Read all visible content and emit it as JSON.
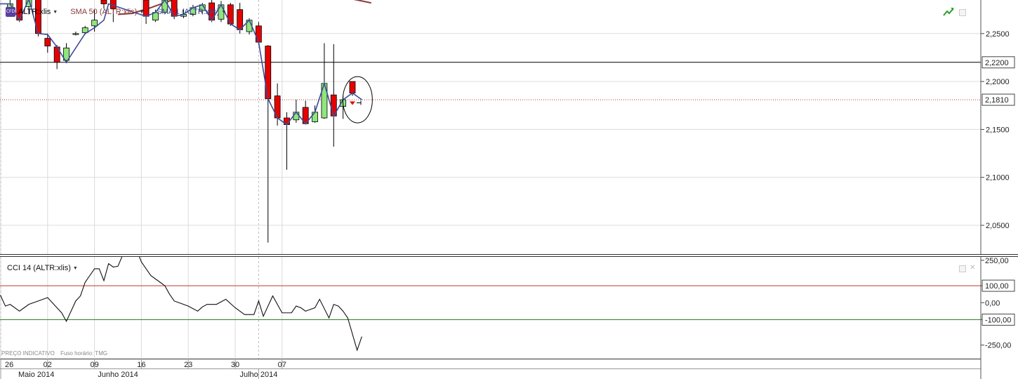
{
  "toolbar": {
    "symbol": "ALTR:xlis",
    "cfd_badge": "CFD",
    "sma50_label": "SMA 50 (ALTR:xlis)",
    "sma1_label": "SMA 1 (ALTR:xlis)"
  },
  "cci": {
    "label": "CCI 14 (ALTR:xlis)"
  },
  "footer": {
    "price_note": "PREÇO INDICATIVO",
    "tz_note": "Fuso horário: TMG"
  },
  "price_axis": {
    "ticks": [
      "2,2500",
      "2,2000",
      "2,1500",
      "2,1000",
      "2,0500"
    ],
    "tick_values": [
      2.25,
      2.2,
      2.15,
      2.1,
      2.05
    ],
    "hline_label": "2,2200",
    "hline_value": 2.22,
    "current_label": "2,1810",
    "current_value": 2.181
  },
  "cci_axis": {
    "ticks": [
      "250,00",
      "100,00",
      "0,00",
      "-100,00",
      "-250,00"
    ],
    "tick_values": [
      250,
      100,
      0,
      -100,
      -250
    ]
  },
  "date_axis": {
    "days": [
      {
        "label": "26",
        "x": 0
      },
      {
        "label": "02",
        "x": 5
      },
      {
        "label": "09",
        "x": 10
      },
      {
        "label": "16",
        "x": 15
      },
      {
        "label": "23",
        "x": 20
      },
      {
        "label": "30",
        "x": 25
      },
      {
        "label": "07",
        "x": 30
      }
    ],
    "months": [
      {
        "label": "Maio 2014",
        "x": 0
      },
      {
        "label": "Junho 2014",
        "x": 12.5
      },
      {
        "label": "Julho 2014",
        "x": 27.5
      }
    ]
  },
  "colors": {
    "up": "#90e57c",
    "down": "#e60000",
    "sma1": "#3c4c9a",
    "sma50": "#8b3a3a",
    "cci": "#111111",
    "cci_upper": "#c0392b",
    "cci_lower": "#1e7a1e",
    "current": "#c0392b"
  },
  "chart_data": [
    {
      "type": "candlestick",
      "title": "ALTR:xlis",
      "x_unit": "trading day index",
      "ylim": [
        2.02,
        2.285
      ],
      "series_names": [
        "SMA 50 (ALTR:xlis)",
        "SMA 1 (ALTR:xlis)"
      ],
      "candles": [
        {
          "x": -0.5,
          "o": 2.283,
          "h": 2.289,
          "l": 2.266,
          "c": 2.281
        },
        {
          "x": 1,
          "o": 2.277,
          "h": 2.292,
          "l": 2.272,
          "c": 2.281
        },
        {
          "x": 2,
          "o": 2.286,
          "h": 2.29,
          "l": 2.262,
          "c": 2.264
        },
        {
          "x": 3,
          "o": 2.278,
          "h": 2.29,
          "l": 2.27,
          "c": 2.286
        },
        {
          "x": 4,
          "o": 2.286,
          "h": 2.29,
          "l": 2.247,
          "c": 2.25
        },
        {
          "x": 5,
          "o": 2.245,
          "h": 2.25,
          "l": 2.23,
          "c": 2.237
        },
        {
          "x": 6,
          "o": 2.236,
          "h": 2.238,
          "l": 2.213,
          "c": 2.22
        },
        {
          "x": 7,
          "o": 2.222,
          "h": 2.24,
          "l": 2.219,
          "c": 2.235
        },
        {
          "x": 8,
          "o": 2.249,
          "h": 2.252,
          "l": 2.248,
          "c": 2.25
        },
        {
          "x": 9,
          "o": 2.251,
          "h": 2.258,
          "l": 2.249,
          "c": 2.256
        },
        {
          "x": 10,
          "o": 2.258,
          "h": 2.275,
          "l": 2.252,
          "c": 2.264
        },
        {
          "x": 11,
          "o": 2.285,
          "h": 2.29,
          "l": 2.276,
          "c": 2.281
        },
        {
          "x": 12,
          "o": 2.287,
          "h": 2.29,
          "l": 2.262,
          "c": 2.276
        },
        {
          "x": 15.5,
          "o": 2.285,
          "h": 2.288,
          "l": 2.26,
          "c": 2.268
        },
        {
          "x": 16.5,
          "o": 2.264,
          "h": 2.275,
          "l": 2.262,
          "c": 2.272
        },
        {
          "x": 17.5,
          "o": 2.272,
          "h": 2.29,
          "l": 2.27,
          "c": 2.285
        },
        {
          "x": 18.5,
          "o": 2.288,
          "h": 2.29,
          "l": 2.265,
          "c": 2.268
        },
        {
          "x": 19.5,
          "o": 2.268,
          "h": 2.275,
          "l": 2.266,
          "c": 2.27
        },
        {
          "x": 20.5,
          "o": 2.27,
          "h": 2.28,
          "l": 2.268,
          "c": 2.277
        },
        {
          "x": 21.5,
          "o": 2.274,
          "h": 2.282,
          "l": 2.27,
          "c": 2.28
        },
        {
          "x": 22.5,
          "o": 2.282,
          "h": 2.285,
          "l": 2.262,
          "c": 2.264
        },
        {
          "x": 23.5,
          "o": 2.265,
          "h": 2.284,
          "l": 2.262,
          "c": 2.28
        },
        {
          "x": 24.5,
          "o": 2.28,
          "h": 2.282,
          "l": 2.258,
          "c": 2.26
        },
        {
          "x": 25.5,
          "o": 2.275,
          "h": 2.282,
          "l": 2.25,
          "c": 2.254
        },
        {
          "x": 26.5,
          "o": 2.252,
          "h": 2.266,
          "l": 2.249,
          "c": 2.264
        },
        {
          "x": 27.5,
          "o": 2.258,
          "h": 2.262,
          "l": 2.238,
          "c": 2.241
        },
        {
          "x": 28.5,
          "o": 2.237,
          "h": 2.238,
          "l": 2.032,
          "c": 2.182
        },
        {
          "x": 29.5,
          "o": 2.185,
          "h": 2.198,
          "l": 2.154,
          "c": 2.162
        },
        {
          "x": 30.5,
          "o": 2.162,
          "h": 2.168,
          "l": 2.108,
          "c": 2.155
        },
        {
          "x": 31.5,
          "o": 2.16,
          "h": 2.181,
          "l": 2.157,
          "c": 2.168
        },
        {
          "x": 32.5,
          "o": 2.173,
          "h": 2.18,
          "l": 2.155,
          "c": 2.156
        },
        {
          "x": 33.5,
          "o": 2.158,
          "h": 2.175,
          "l": 2.157,
          "c": 2.168
        },
        {
          "x": 34.5,
          "o": 2.162,
          "h": 2.24,
          "l": 2.161,
          "c": 2.198
        },
        {
          "x": 35.5,
          "o": 2.186,
          "h": 2.239,
          "l": 2.132,
          "c": 2.164
        },
        {
          "x": 36.5,
          "o": 2.174,
          "h": 2.185,
          "l": 2.161,
          "c": 2.181
        },
        {
          "x": 37.5,
          "o": 2.2,
          "h": 2.2,
          "l": 2.185,
          "c": 2.188
        }
      ],
      "sma1": [
        [
          -0.5,
          2.281
        ],
        [
          1,
          2.281
        ],
        [
          2,
          2.264
        ],
        [
          3,
          2.286
        ],
        [
          4,
          2.25
        ],
        [
          5,
          2.249
        ],
        [
          6,
          2.236
        ],
        [
          7,
          2.22
        ],
        [
          8,
          2.235
        ],
        [
          9,
          2.25
        ],
        [
          10,
          2.256
        ],
        [
          11,
          2.264
        ],
        [
          11.5,
          2.281
        ],
        [
          15.5,
          2.268
        ],
        [
          16.5,
          2.272
        ],
        [
          17.5,
          2.285
        ],
        [
          18.5,
          2.268
        ],
        [
          19.5,
          2.27
        ],
        [
          20.5,
          2.277
        ],
        [
          21.5,
          2.28
        ],
        [
          22.5,
          2.264
        ],
        [
          23.5,
          2.28
        ],
        [
          24.5,
          2.26
        ],
        [
          25.5,
          2.254
        ],
        [
          26.5,
          2.264
        ],
        [
          27.5,
          2.241
        ],
        [
          28.5,
          2.182
        ],
        [
          29.5,
          2.162
        ],
        [
          30.5,
          2.155
        ],
        [
          31.5,
          2.168
        ],
        [
          32.5,
          2.156
        ],
        [
          33.5,
          2.168
        ],
        [
          34.5,
          2.198
        ],
        [
          35.5,
          2.164
        ],
        [
          36.5,
          2.181
        ],
        [
          37.5,
          2.188
        ],
        [
          38.5,
          2.181
        ]
      ],
      "sma50": [
        [
          12.5,
          2.27
        ],
        [
          14,
          2.271
        ],
        [
          16,
          2.277
        ],
        [
          18,
          2.284
        ],
        [
          20,
          2.289
        ],
        [
          24,
          2.292
        ],
        [
          28,
          2.295
        ],
        [
          30,
          2.295
        ],
        [
          34,
          2.292
        ],
        [
          37,
          2.287
        ],
        [
          39.5,
          2.282
        ]
      ],
      "annotations": {
        "circle_center": [
          37.6,
          2.181
        ],
        "marker": [
          37.5,
          2.177
        ]
      }
    },
    {
      "type": "line",
      "title": "CCI 14 (ALTR:xlis)",
      "ylim": [
        -330,
        270
      ],
      "upper_level": 100,
      "lower_level": -100,
      "x": [
        -0.5,
        0,
        0.5,
        1,
        2,
        2.5,
        3,
        4,
        5,
        5.5,
        6,
        6.5,
        7,
        7.5,
        8,
        8.5,
        9,
        10,
        10.5,
        11,
        11.5,
        12,
        12.5,
        13,
        14,
        14.5,
        15,
        16,
        17,
        17.5,
        18,
        18.5,
        19,
        20,
        21,
        21.5,
        22,
        23,
        24,
        25,
        26,
        27,
        27.5,
        28,
        29,
        30,
        31,
        31.5,
        32,
        32.5,
        33,
        33.5,
        34,
        35,
        35.5,
        36,
        36.5,
        37,
        38,
        38.5
      ],
      "y": [
        55,
        40,
        -20,
        -10,
        -50,
        -30,
        -10,
        10,
        30,
        0,
        -30,
        -60,
        -110,
        -50,
        10,
        40,
        120,
        200,
        200,
        130,
        230,
        210,
        215,
        280,
        355,
        310,
        240,
        160,
        120,
        100,
        50,
        10,
        0,
        -20,
        -50,
        -25,
        -10,
        -10,
        20,
        -30,
        -70,
        -70,
        10,
        -80,
        40,
        -60,
        -60,
        -20,
        -30,
        -50,
        -40,
        -30,
        20,
        -90,
        -10,
        -20,
        -50,
        -90,
        -280,
        -200,
        -180,
        -80,
        -40,
        10,
        0,
        30
      ]
    }
  ]
}
